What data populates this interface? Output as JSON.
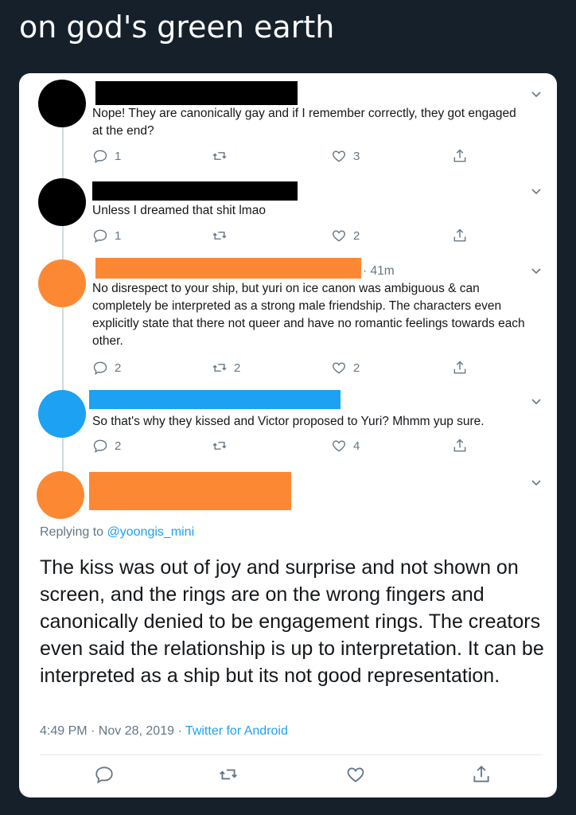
{
  "caption": "on god's green earth",
  "colors": {
    "background": "#15202b",
    "card": "#ffffff",
    "text": "#14171a",
    "muted": "#657786",
    "link": "#1da1f2",
    "redaction_black": "#000000",
    "redaction_orange": "#fd8833",
    "redaction_blue": "#1da1f2"
  },
  "tweets": [
    {
      "text": "Nope! They are canonically gay and if I remember correctly, they got engaged at the end?",
      "time": "",
      "reply_count": "1",
      "retweet_count": "",
      "like_count": "3"
    },
    {
      "text": "Unless I dreamed that shit lmao",
      "time": "",
      "reply_count": "1",
      "retweet_count": "",
      "like_count": "2"
    },
    {
      "text": "No disrespect to your ship, but yuri on ice canon was ambiguous & can completely be interpreted as a strong male friendship. The characters even explicitly state that there not queer and have no romantic feelings towards each other.",
      "time": "· 41m",
      "reply_count": "2",
      "retweet_count": "2",
      "like_count": "2"
    },
    {
      "text": "So that's why they kissed and Victor proposed to Yuri? Mhmm yup sure.",
      "time": "",
      "reply_count": "2",
      "retweet_count": "",
      "like_count": "4"
    }
  ],
  "main_tweet": {
    "replying_prefix": "Replying to",
    "replying_handle": "@yoongis_mini",
    "text": "The kiss was out of joy and surprise and not shown on screen, and the rings are on the wrong fingers and canonically denied to be engagement rings. The creators even said the relationship is up to interpretation. It can be interpreted as a ship but its not good representation.",
    "timestamp": "4:49 PM · Nov 28, 2019 · ",
    "client": "Twitter for Android"
  },
  "icons": {
    "reply": "reply-icon",
    "retweet": "retweet-icon",
    "like": "like-icon",
    "share": "share-icon",
    "more": "chevron-down-icon"
  }
}
